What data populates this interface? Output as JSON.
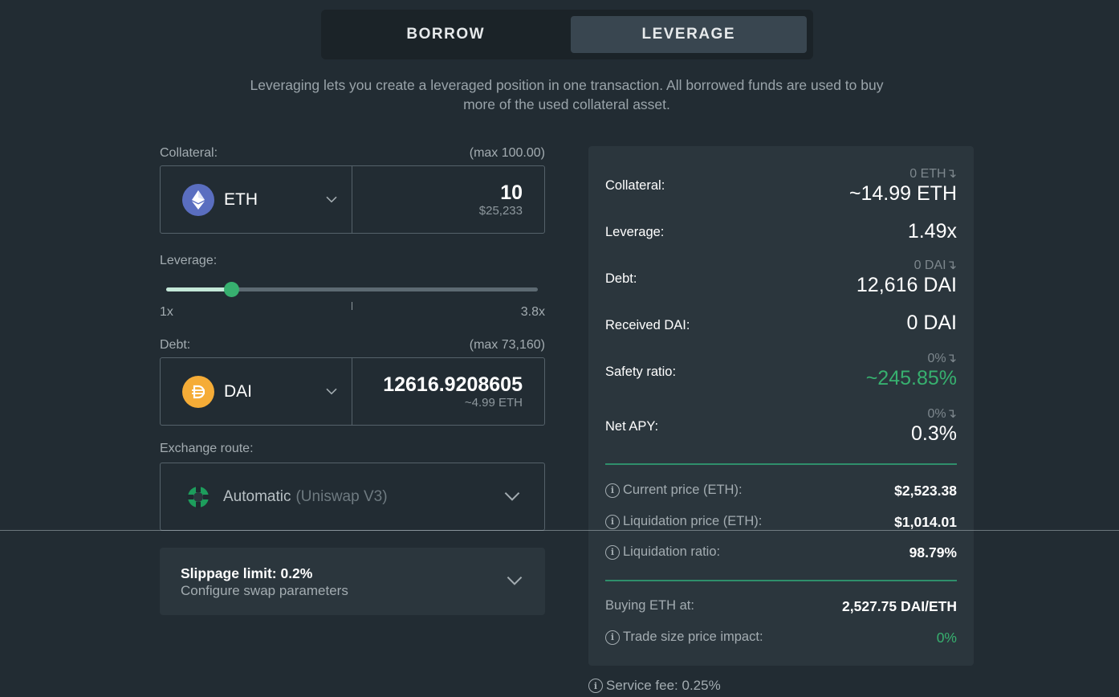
{
  "tabs": [
    {
      "label": "BORROW",
      "active": false
    },
    {
      "label": "LEVERAGE",
      "active": true
    }
  ],
  "intro": "Leveraging lets you create a leveraged position in one transaction. All borrowed funds are used to buy more of the used collateral asset.",
  "collateral": {
    "label": "Collateral:",
    "max": "(max 100.00)",
    "asset": "ETH",
    "amount": "10",
    "usd": "$25,233"
  },
  "leverage": {
    "label": "Leverage:",
    "min": "1x",
    "max": "3.8x",
    "value": 1.49,
    "range": [
      1,
      3.8
    ]
  },
  "debt": {
    "label": "Debt:",
    "max": "(max 73,160)",
    "asset": "DAI",
    "amount": "12616.9208605",
    "sub": "~4.99 ETH"
  },
  "exchange": {
    "label": "Exchange route:",
    "main": "Automatic",
    "sub": "(Uniswap V3)"
  },
  "slippage": {
    "title": "Slippage limit: 0.2%",
    "sub": "Configure swap parameters"
  },
  "summary": {
    "collateral": {
      "label": "Collateral:",
      "prev": "0 ETH↴",
      "value": "~14.99 ETH"
    },
    "leverage": {
      "label": "Leverage:",
      "value": "1.49x"
    },
    "debt": {
      "label": "Debt:",
      "prev": "0 DAI↴",
      "value": "12,616 DAI"
    },
    "received": {
      "label": "Received DAI:",
      "value": "0 DAI"
    },
    "safety": {
      "label": "Safety ratio:",
      "prev": "0%↴",
      "value": "~245.85%"
    },
    "apy": {
      "label": "Net APY:",
      "prev": "0%↴",
      "value": "0.3%"
    },
    "current_price": {
      "label": "Current price (ETH):",
      "value": "$2,523.38"
    },
    "liq_price": {
      "label": "Liquidation price (ETH):",
      "value": "$1,014.01"
    },
    "liq_ratio": {
      "label": "Liquidation ratio:",
      "value": "98.79%"
    },
    "buying": {
      "label": "Buying ETH at:",
      "value": "2,527.75 DAI/ETH"
    },
    "impact": {
      "label": "Trade size price impact:",
      "value": "0%"
    }
  },
  "fee": "Service fee: 0.25%",
  "colors": {
    "accent_green": "#37b06f",
    "background": "#222c33",
    "panel": "#2b363d"
  }
}
